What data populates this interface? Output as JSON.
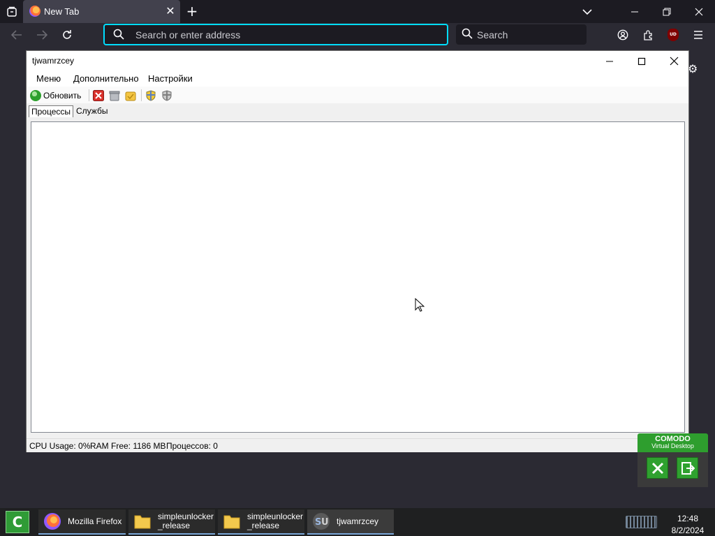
{
  "browser": {
    "tab": {
      "title": "New Tab"
    },
    "urlbar": {
      "placeholder": "Search or enter address"
    },
    "searchbar": {
      "placeholder": "Search"
    },
    "ublock_badge": "UD",
    "accent_color": "#00ddff"
  },
  "app_window": {
    "title": "tjwamrzcey",
    "menu": [
      "Меню",
      "Дополнительно",
      "Настройки"
    ],
    "toolbar": {
      "refresh_label": "Обновить",
      "icons": [
        "refresh-icon",
        "kill-process-icon",
        "delete-icon",
        "unlock-icon",
        "shield-yellow-icon",
        "shield-gray-icon"
      ]
    },
    "tabs": [
      {
        "label": "Процессы",
        "active": true
      },
      {
        "label": "Службы",
        "active": false
      }
    ],
    "status": {
      "cpu": "CPU Usage: 0%",
      "ram": "RAM Free: 1186 MB",
      "processes": "Процессов: 0"
    }
  },
  "comodo_widget": {
    "name": "COMODO",
    "subtitle": "Virtual Desktop",
    "color": "#2e9e2e"
  },
  "taskbar": {
    "items": [
      {
        "label": "Mozilla Firefox",
        "icon": "firefox-icon"
      },
      {
        "label": "simpleunlocker\n_release",
        "icon": "folder-icon"
      },
      {
        "label": "simpleunlocker\n_release",
        "icon": "folder-icon"
      },
      {
        "label": "tjwamrzcey",
        "icon": "su-app-icon"
      }
    ],
    "time": "12:48",
    "date": "8/2/2024"
  }
}
